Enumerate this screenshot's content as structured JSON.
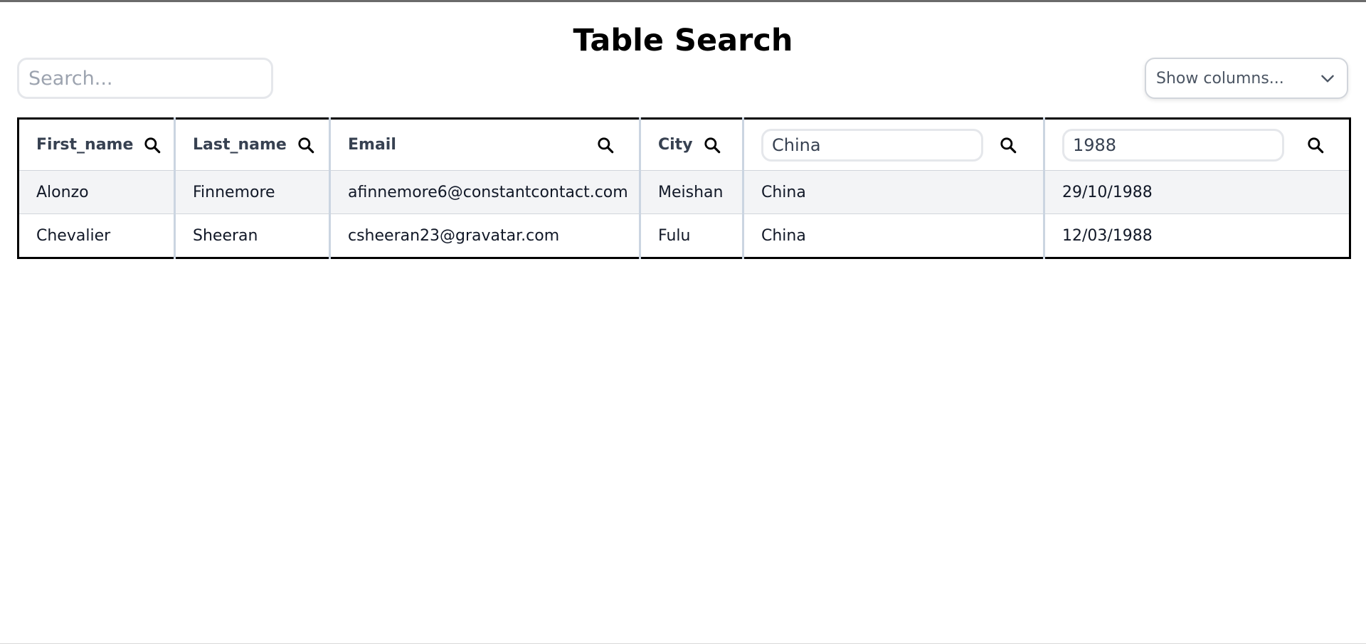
{
  "page": {
    "title": "Table Search"
  },
  "search": {
    "placeholder": "Search..."
  },
  "columns_select": {
    "label": "Show columns..."
  },
  "table": {
    "headers": [
      "First_name",
      "Last_name",
      "Email",
      "City",
      "",
      ""
    ],
    "filters": {
      "country": "China",
      "birth": "1988"
    },
    "rows": [
      [
        "Alonzo",
        "Finnemore",
        "afinnemore6@constantcontact.com",
        "Meishan",
        "China",
        "29/10/1988"
      ],
      [
        "Chevalier",
        "Sheeran",
        "csheeran23@gravatar.com",
        "Fulu",
        "China",
        "12/03/1988"
      ]
    ]
  },
  "icons": {
    "search": "search-icon",
    "dropdown": "chevron-down-icon"
  },
  "colors": {
    "row_alt": "#f3f4f6",
    "border": "#cbd5e1",
    "table_border": "#000000"
  }
}
